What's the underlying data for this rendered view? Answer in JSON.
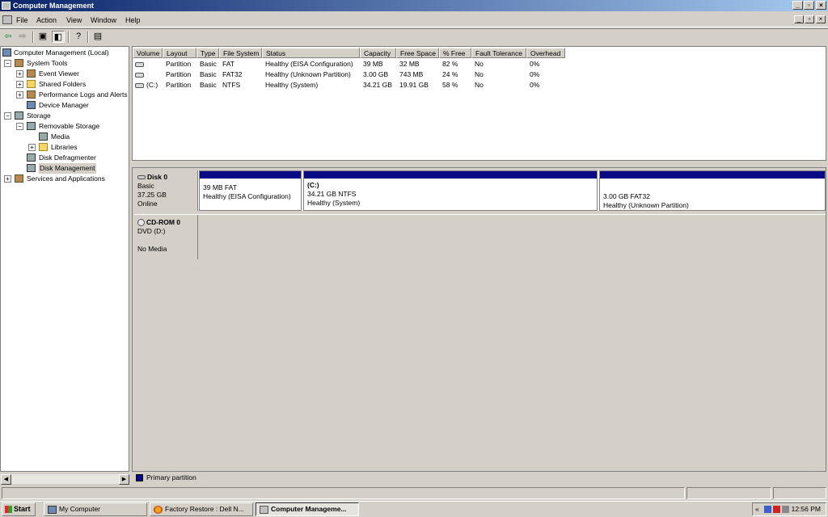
{
  "window": {
    "title": "Computer Management"
  },
  "menu": [
    "File",
    "Action",
    "View",
    "Window",
    "Help"
  ],
  "tree": [
    {
      "label": "Computer Management (Local)",
      "level": 0,
      "expander": "",
      "icon": "computer-icon"
    },
    {
      "label": "System Tools",
      "level": 1,
      "expander": "−",
      "icon": "tools-icon"
    },
    {
      "label": "Event Viewer",
      "level": 2,
      "expander": "+",
      "icon": "event-viewer-icon"
    },
    {
      "label": "Shared Folders",
      "level": 2,
      "expander": "+",
      "icon": "shared-folder-icon"
    },
    {
      "label": "Performance Logs and Alerts",
      "level": 2,
      "expander": "+",
      "icon": "performance-icon"
    },
    {
      "label": "Device Manager",
      "level": 2,
      "expander": "",
      "icon": "device-manager-icon"
    },
    {
      "label": "Storage",
      "level": 1,
      "expander": "−",
      "icon": "storage-icon"
    },
    {
      "label": "Removable Storage",
      "level": 2,
      "expander": "−",
      "icon": "removable-storage-icon"
    },
    {
      "label": "Media",
      "level": 3,
      "expander": "",
      "icon": "media-icon"
    },
    {
      "label": "Libraries",
      "level": 3,
      "expander": "+",
      "icon": "folder-icon"
    },
    {
      "label": "Disk Defragmenter",
      "level": 2,
      "expander": "",
      "icon": "defragmenter-icon"
    },
    {
      "label": "Disk Management",
      "level": 2,
      "expander": "",
      "icon": "disk-management-icon",
      "selected": true
    },
    {
      "label": "Services and Applications",
      "level": 1,
      "expander": "+",
      "icon": "services-icon"
    }
  ],
  "volume_columns": [
    "Volume",
    "Layout",
    "Type",
    "File System",
    "Status",
    "Capacity",
    "Free Space",
    "% Free",
    "Fault Tolerance",
    "Overhead"
  ],
  "volumes": [
    [
      "",
      "Partition",
      "Basic",
      "FAT",
      "Healthy (EISA Configuration)",
      "39 MB",
      "32 MB",
      "82 %",
      "No",
      "0%"
    ],
    [
      "",
      "Partition",
      "Basic",
      "FAT32",
      "Healthy (Unknown Partition)",
      "3.00 GB",
      "743 MB",
      "24 %",
      "No",
      "0%"
    ],
    [
      "(C:)",
      "Partition",
      "Basic",
      "NTFS",
      "Healthy (System)",
      "34.21 GB",
      "19.91 GB",
      "58 %",
      "No",
      "0%"
    ]
  ],
  "disks": {
    "disk0": {
      "name": "Disk 0",
      "type": "Basic",
      "size": "37.25 GB",
      "state": "Online",
      "partitions": [
        {
          "title": "",
          "size": "39 MB FAT",
          "status": "Healthy (EISA Configuration)"
        },
        {
          "title": "(C:)",
          "size": "34.21 GB NTFS",
          "status": "Healthy (System)"
        },
        {
          "title": "",
          "size": "3.00 GB FAT32",
          "status": "Healthy (Unknown Partition)"
        }
      ]
    },
    "cdrom0": {
      "name": "CD-ROM 0",
      "type": "DVD (D:)",
      "state": "No Media"
    }
  },
  "legend": {
    "label": "Primary partition",
    "color": "#0a0a84"
  },
  "taskbar": {
    "start": "Start",
    "tasks": [
      "My Computer",
      "Factory Restore : Dell N...",
      "Computer Manageme..."
    ],
    "tray_chevron": "«",
    "clock": "12:56 PM"
  }
}
